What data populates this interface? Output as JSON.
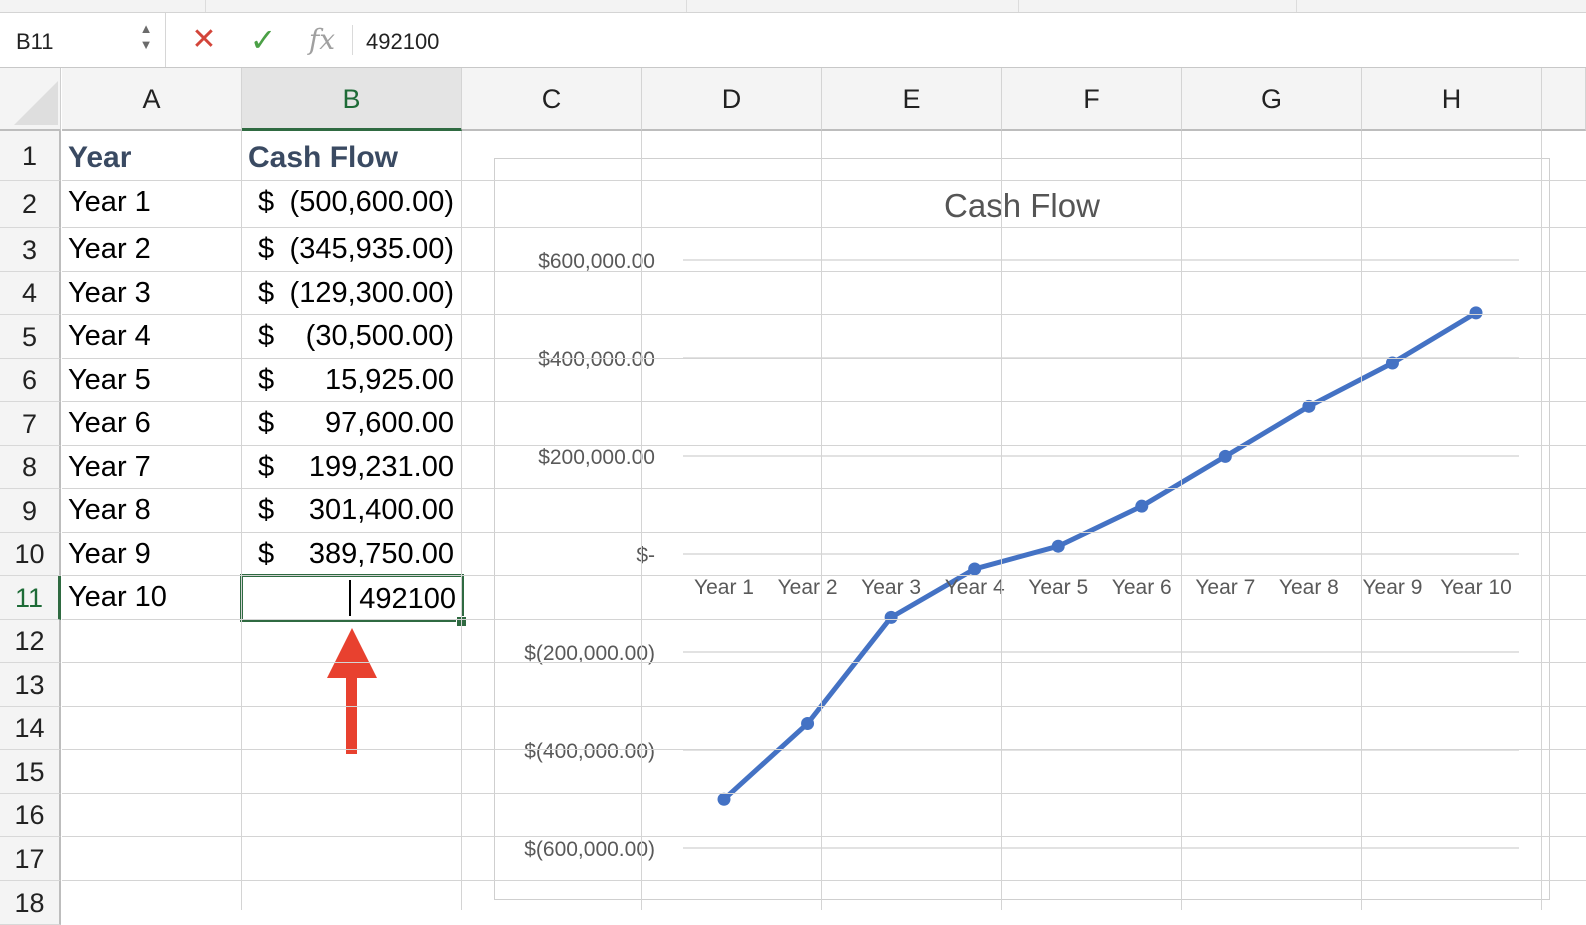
{
  "formula_bar": {
    "name_box": "B11",
    "stepper": "▲\n▼",
    "cancel_glyph": "✕",
    "enter_glyph": "✓",
    "fx_label": "fx",
    "formula_value": "492100"
  },
  "columns": [
    "A",
    "B",
    "C",
    "D",
    "E",
    "F",
    "G",
    "H"
  ],
  "selected_column": "B",
  "rows": [
    "1",
    "2",
    "3",
    "4",
    "5",
    "6",
    "7",
    "8",
    "9",
    "10",
    "11",
    "12",
    "13",
    "14",
    "15",
    "16",
    "17",
    "18"
  ],
  "selected_row": "11",
  "sheet": {
    "header": {
      "year": "Year",
      "cash_flow": "Cash Flow"
    },
    "data": [
      {
        "year": "Year 1",
        "currency": "$",
        "amount": "(500,600.00)"
      },
      {
        "year": "Year 2",
        "currency": "$",
        "amount": "(345,935.00)"
      },
      {
        "year": "Year 3",
        "currency": "$",
        "amount": "(129,300.00)"
      },
      {
        "year": "Year 4",
        "currency": "$",
        "amount": "(30,500.00)"
      },
      {
        "year": "Year 5",
        "currency": "$",
        "amount": "15,925.00"
      },
      {
        "year": "Year 6",
        "currency": "$",
        "amount": "97,600.00"
      },
      {
        "year": "Year 7",
        "currency": "$",
        "amount": "199,231.00"
      },
      {
        "year": "Year 8",
        "currency": "$",
        "amount": "301,400.00"
      },
      {
        "year": "Year 9",
        "currency": "$",
        "amount": "389,750.00"
      }
    ],
    "editing_row": {
      "year": "Year 10",
      "value": "492100"
    }
  },
  "colors": {
    "accent_green": "#2f6a41",
    "line_blue": "#4472c4",
    "arrow_red": "#e8412f",
    "header_text": "#3a4a62"
  },
  "chart_data": {
    "type": "line",
    "title": "Cash Flow",
    "categories": [
      "Year 1",
      "Year 2",
      "Year 3",
      "Year 4",
      "Year 5",
      "Year 6",
      "Year 7",
      "Year 8",
      "Year 9",
      "Year 10"
    ],
    "values": [
      -500600,
      -345935,
      -129300,
      -30500,
      15925,
      97600,
      199231,
      301400,
      389750,
      492100
    ],
    "ylim": [
      -600000,
      600000
    ],
    "yticks": [
      600000,
      400000,
      200000,
      0,
      -200000,
      -400000,
      -600000
    ],
    "ytick_labels": [
      "$600,000.00",
      "$400,000.00",
      "$200,000.00",
      "$-",
      "$(200,000.00)",
      "$(400,000.00)",
      "$(600,000.00)"
    ],
    "grid": true,
    "legend": "none",
    "xlabel": "",
    "ylabel": ""
  }
}
